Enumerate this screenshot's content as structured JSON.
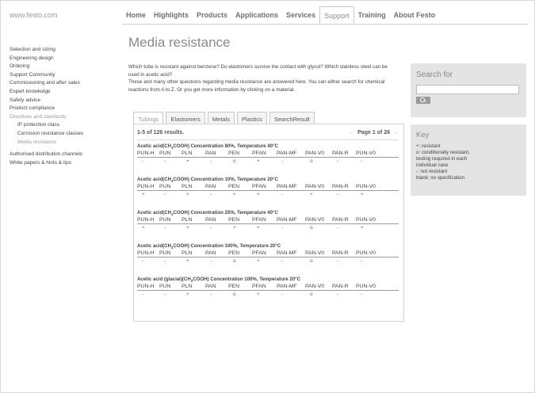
{
  "site": {
    "logo": "www.festo.com"
  },
  "nav": {
    "items": [
      {
        "label": "Home",
        "active": false
      },
      {
        "label": "Highlights",
        "active": false
      },
      {
        "label": "Products",
        "active": false
      },
      {
        "label": "Applications",
        "active": false
      },
      {
        "label": "Services",
        "active": false
      },
      {
        "label": "Support",
        "active": true
      },
      {
        "label": "Training",
        "active": false
      },
      {
        "label": "About Festo",
        "active": false
      }
    ]
  },
  "sidebar": {
    "items": [
      "Selection and sizing",
      "Engineering design",
      "Ordering",
      "Support Community",
      "Commissioning and after sales",
      "Expert knowledge",
      "Safety advice",
      "Product compliance",
      "Directives and standards",
      "IP protection class",
      "Corrosion resistance classes",
      "Media resistance",
      "Authorised distribution channels",
      "White papers & hints & tips"
    ]
  },
  "main": {
    "title": "Media resistance",
    "intro_1": "Which tube is resistant against benzene? Do elastomers survive the contact with glycol? Which stainless steel can be used in acetic acid?",
    "intro_2": "These and many other questions regarding media resistance are answered here. You can either search for chemical reactions from A to Z. Or you get more information by clicking on a material.",
    "tabs": [
      "Tubings",
      "Elastomers",
      "Metals",
      "Plastics",
      "SearchResult"
    ],
    "results_count": "1-5 of 126 results.",
    "pager": {
      "prev": "←",
      "text": "Page 1 of 26",
      "next": "→"
    },
    "columns": [
      "PUN-H",
      "PUN",
      "PLN",
      "PAN",
      "PEN",
      "PFAN",
      "PAN-MF",
      "PAN-V0",
      "PAN-R",
      "PUN-V0"
    ],
    "results": [
      {
        "name": "Acetic acid(CH",
        "sub": "3",
        "rest": "COOH) Concentration 80%, Temperature 40°C",
        "values": [
          "-",
          "-",
          "+",
          "-",
          "o",
          "+",
          "-",
          "o",
          "-",
          "-"
        ]
      },
      {
        "name": "Acetic acid(CH",
        "sub": "3",
        "rest": "COOH) Concentration 10%, Temperature 20°C",
        "values": [
          "+",
          "-",
          "+",
          "-",
          "+",
          "+",
          "-",
          "+",
          "-",
          "+"
        ]
      },
      {
        "name": "Acetic acid(CH",
        "sub": "3",
        "rest": "COOH) Concentration 25%, Temperature 40°C",
        "values": [
          "+",
          "-",
          "+",
          "-",
          "+",
          "+",
          "-",
          "o",
          "-",
          "+"
        ]
      },
      {
        "name": "Acetic acid(CH",
        "sub": "3",
        "rest": "COOH) Concentration 100%, Temperature 20°C",
        "values": [
          "-",
          "-",
          "+",
          "-",
          "o",
          "+",
          "-",
          "o",
          "-",
          "-"
        ]
      },
      {
        "name": "Acetic acid (glacial)(CH",
        "sub": "3",
        "rest": "COOH) Concentration 100%, Temperature 20°C",
        "values": [
          "-",
          "-",
          "+",
          "-",
          "o",
          "+",
          "-",
          "o",
          "-",
          "-"
        ]
      }
    ]
  },
  "search": {
    "title": "Search for",
    "value": ""
  },
  "key": {
    "title": "Key",
    "lines": [
      "+: resistant",
      "o: conditionally resistant,",
      "testing required in each",
      "individual case",
      "-: not resistant",
      "blank: no specification"
    ]
  },
  "colors": {
    "panel_grey": "#e4e4e4",
    "title_grey": "#8a8a8a",
    "border": "#d2d2d2"
  }
}
